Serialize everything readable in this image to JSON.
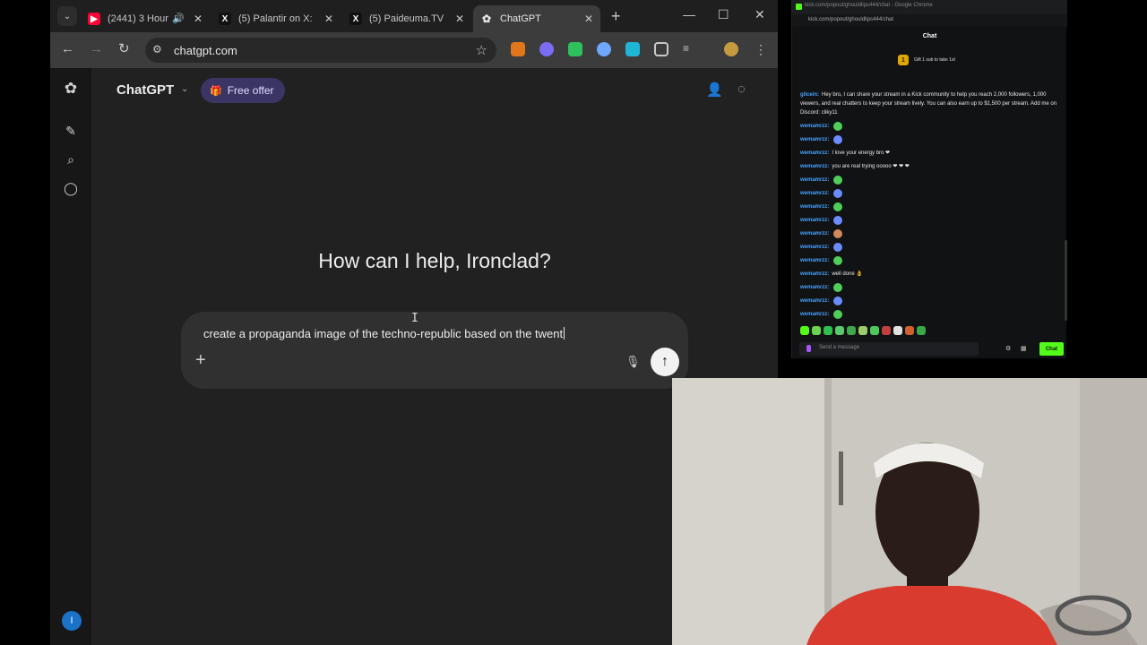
{
  "browser": {
    "tabs": [
      {
        "title": "(2441) 3 Hour",
        "favicon": "youtube-icon",
        "color": "#ff0033"
      },
      {
        "title": "(5) Palantir on X:",
        "favicon": "x-icon",
        "color": "#000000"
      },
      {
        "title": "(5) Paideuma.TV",
        "favicon": "x-icon",
        "color": "#000000"
      },
      {
        "title": "ChatGPT",
        "favicon": "chatgpt-icon",
        "color": "#ffffff"
      }
    ],
    "url": "chatgpt.com"
  },
  "chatgpt": {
    "model_label": "ChatGPT",
    "offer_label": "Free offer",
    "greeting": "How can I help, Ironclad?",
    "prompt_text": "create a propaganda image of the techno-republic based on the twent",
    "avatar_initial": "I"
  },
  "kick_chat": {
    "window_title": "kick.com/popout/ghouldlips444/chat - Google Chrome",
    "url": "kick.com/popout/ghouldlips444/chat",
    "header": "Chat",
    "gift_count": "1",
    "gift_label": "Gift 1 sub to take 1st",
    "promo_user": "gilcein:",
    "promo_text": "Hey bro, I can share your stream in a Kick community to help you reach 2,000 followers, 1,000 viewers, and real chatters to keep your stream lively. You can also earn up to $1,500 per stream. Add me on Discord: cliky11",
    "messages": [
      {
        "user": "wemamrzz:",
        "text": ""
      },
      {
        "user": "wemamrzz:",
        "text": ""
      },
      {
        "user": "wemamrzz:",
        "text": "I love your energy bro ❤"
      },
      {
        "user": "wemamrzz:",
        "text": "you are real trying ooooo ❤ ❤ ❤"
      },
      {
        "user": "wemamrzz:",
        "text": ""
      },
      {
        "user": "wemamrzz:",
        "text": ""
      },
      {
        "user": "wemamrzz:",
        "text": ""
      },
      {
        "user": "wemamrzz:",
        "text": ""
      },
      {
        "user": "wemamrzz:",
        "text": ""
      },
      {
        "user": "wemamrzz:",
        "text": ""
      },
      {
        "user": "wemamrzz:",
        "text": ""
      },
      {
        "user": "wemamrzz:",
        "text": "well done 👌"
      },
      {
        "user": "wemamrzz:",
        "text": ""
      },
      {
        "user": "wemamrzz:",
        "text": ""
      },
      {
        "user": "wemamrzz:",
        "text": ""
      }
    ],
    "input_placeholder": "Send a message",
    "send_label": "Chat"
  },
  "colors": {
    "chatgpt_bg": "#212121",
    "offer_bg": "#3b3566",
    "kick_green": "#53fc18",
    "username_blue": "#4aa3ff"
  }
}
